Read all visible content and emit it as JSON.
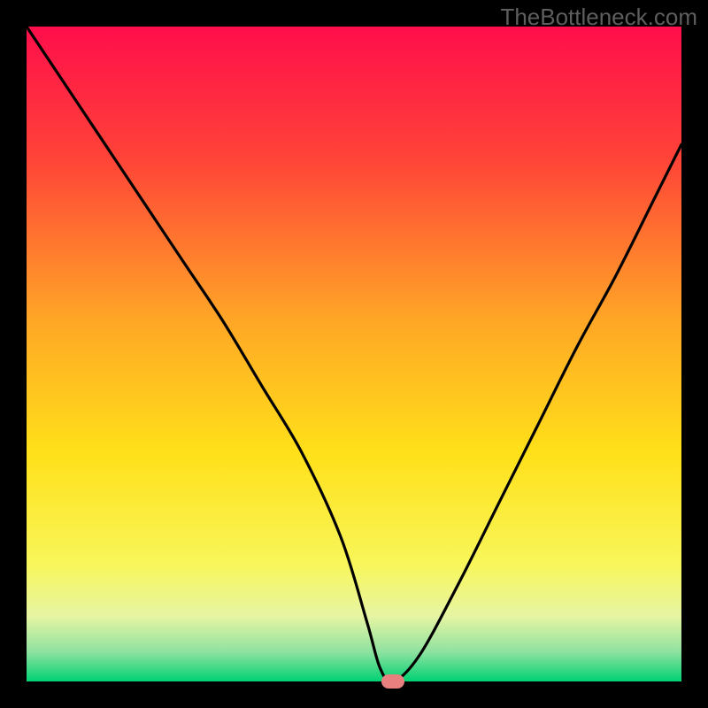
{
  "watermark": "TheBottleneck.com",
  "chart_data": {
    "type": "line",
    "title": "",
    "xlabel": "",
    "ylabel": "",
    "xlim": [
      0,
      100
    ],
    "ylim": [
      0,
      100
    ],
    "grid": false,
    "series": [
      {
        "name": "bottleneck-curve",
        "x": [
          0,
          6,
          12,
          18,
          24,
          30,
          36,
          42,
          48,
          52,
          54,
          56,
          60,
          66,
          72,
          78,
          84,
          90,
          96,
          100
        ],
        "values": [
          100,
          91,
          82,
          73,
          64,
          55,
          45,
          35,
          22,
          9,
          2,
          0,
          4,
          15,
          27,
          39,
          51,
          62,
          74,
          82
        ]
      }
    ],
    "marker": {
      "x": 56,
      "y": 0,
      "color": "#e98080"
    },
    "background_gradient": {
      "stops": [
        {
          "pos": 0.0,
          "color": "#ff0e4b"
        },
        {
          "pos": 0.2,
          "color": "#ff4338"
        },
        {
          "pos": 0.45,
          "color": "#ffa726"
        },
        {
          "pos": 0.65,
          "color": "#ffe019"
        },
        {
          "pos": 0.82,
          "color": "#f8f65a"
        },
        {
          "pos": 0.9,
          "color": "#e7f5a3"
        },
        {
          "pos": 0.955,
          "color": "#8ee2a0"
        },
        {
          "pos": 1.0,
          "color": "#00d173"
        }
      ]
    }
  }
}
